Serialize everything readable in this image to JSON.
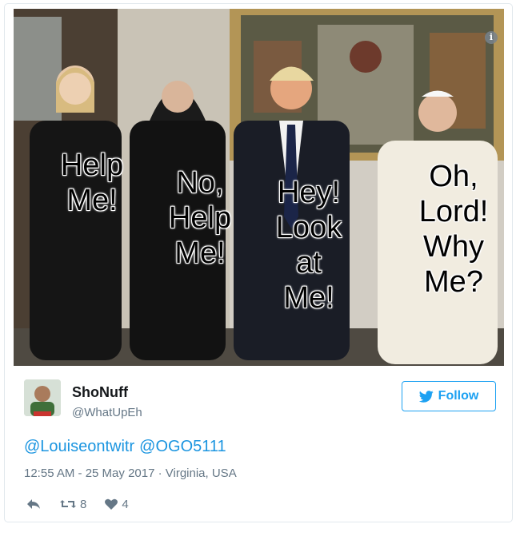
{
  "media": {
    "captions": [
      "Help\nMe!",
      "No,\nHelp\nMe!",
      "Hey!\nLook\nat\nMe!",
      "Oh,\nLord!\nWhy\nMe?"
    ],
    "info_glyph": "i"
  },
  "tweet": {
    "display_name": "ShoNuff",
    "handle": "@WhatUpEh",
    "follow_label": "Follow",
    "mentions": [
      "@Louiseontwitr",
      "@OGO5111"
    ],
    "meta": "12:55 AM - 25 May 2017 · Virginia, USA",
    "retweet_count": "8",
    "like_count": "4"
  },
  "colors": {
    "accent": "#1da1f2",
    "link": "#1b95e0",
    "muted": "#657786"
  },
  "icons": [
    "info-icon",
    "twitter-bird-icon",
    "reply-icon",
    "retweet-icon",
    "heart-icon"
  ]
}
